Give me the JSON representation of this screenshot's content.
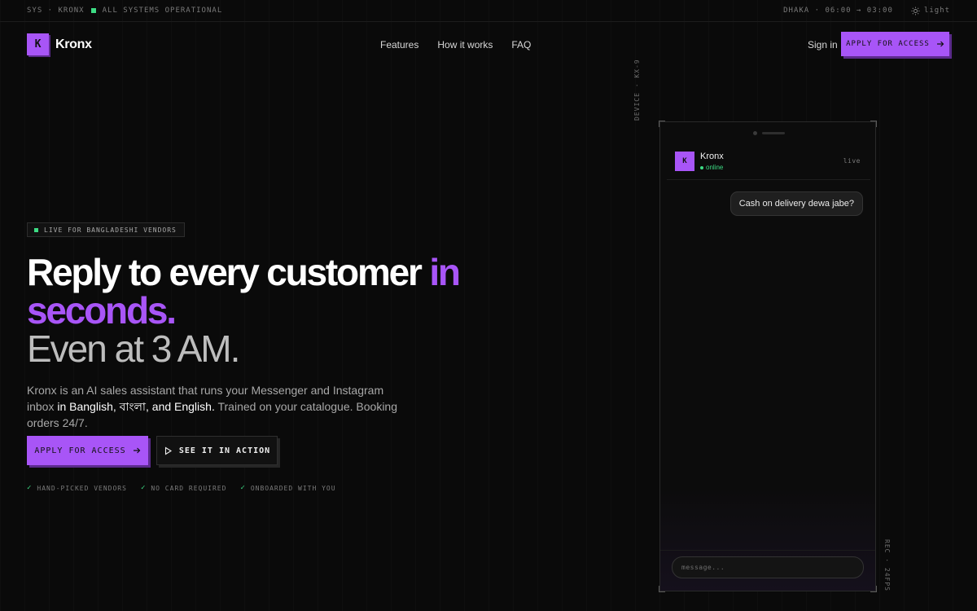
{
  "status_bar": {
    "left_text": "SYS · KRONX",
    "status_text": "ALL SYSTEMS OPERATIONAL",
    "status_color": "#3ddc84",
    "right_text": "DHAKA · 06:00 → 03:00",
    "theme_toggle_label": "light",
    "theme_icon": "sun-icon"
  },
  "nav": {
    "logo_mark": "K",
    "brand": "Kronx",
    "links": [
      "Features",
      "How it works",
      "FAQ"
    ],
    "signin_label": "Sign in",
    "cta_label": "APPLY FOR ACCESS",
    "cta_icon": "arrow-right-icon"
  },
  "hero": {
    "badge": "LIVE FOR BANGLADESHI VENDORS",
    "headline_part1": "Reply to every customer",
    "headline_accent": "in seconds.",
    "headline_part2": "Even at 3 AM.",
    "sub_start": "Kronx is an AI sales assistant that runs your Messenger and Instagram inbox",
    "sub_highlight": "in Banglish, বাংলা, and English.",
    "sub_end": "Trained on your catalogue. Booking orders 24/7.",
    "primary_cta": "APPLY FOR ACCESS",
    "secondary_cta": "SEE IT IN ACTION",
    "secondary_icon": "play-icon",
    "checks": [
      "HAND-PICKED VENDORS",
      "NO CARD REQUIRED",
      "ONBOARDED WITH YOU"
    ]
  },
  "device": {
    "side_label_top": "DEVICE · KX-9",
    "side_label_bottom": "REC · 24FPS",
    "chat": {
      "avatar": "K",
      "name": "Kronx",
      "status": "online",
      "live_label": "live",
      "message": "Cash on delivery dewa jabe?",
      "composer_placeholder": "message..."
    }
  },
  "colors": {
    "accent": "#a855f7",
    "background": "#0a0a0a",
    "success": "#3ddc84"
  }
}
